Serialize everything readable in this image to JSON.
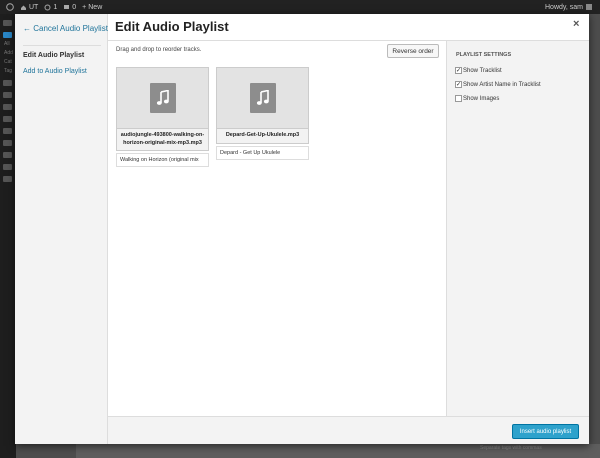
{
  "admin_bar": {
    "site_name": "UT",
    "updates_count": "1",
    "comments_count": "0",
    "new_label": "New",
    "greeting": "Howdy, sam"
  },
  "wp_sidebar": {
    "fragments": [
      "All",
      "Add",
      "Cat",
      "Tag"
    ]
  },
  "background": {
    "fragment": "Separate tags with commas"
  },
  "menu": {
    "cancel": "← Cancel Audio Playlist",
    "edit": "Edit Audio Playlist",
    "add": "Add to Audio Playlist"
  },
  "frame": {
    "title": "Edit Audio Playlist",
    "close_glyph": "×"
  },
  "toolbar_top": {
    "hint": "Drag and drop to reorder tracks.",
    "reverse_label": "Reverse order"
  },
  "tracks": [
    {
      "filename": "audiojungle-493800-walking-on-horizon-original-mix-mp3.mp3",
      "caption": "Walking on Horizon (original mix"
    },
    {
      "filename": "Depard-Get-Up-Ukulele.mp3",
      "caption": "Depard - Get Up Ukulele"
    }
  ],
  "settings": {
    "heading": "PLAYLIST SETTINGS",
    "options": [
      {
        "label": "Show Tracklist",
        "checked": true
      },
      {
        "label": "Show Artist Name in Tracklist",
        "checked": true
      },
      {
        "label": "Show Images",
        "checked": false
      }
    ]
  },
  "footer": {
    "insert_label": "Insert audio playlist"
  },
  "colors": {
    "primary": "#2ea2cc",
    "link": "#21759b"
  }
}
